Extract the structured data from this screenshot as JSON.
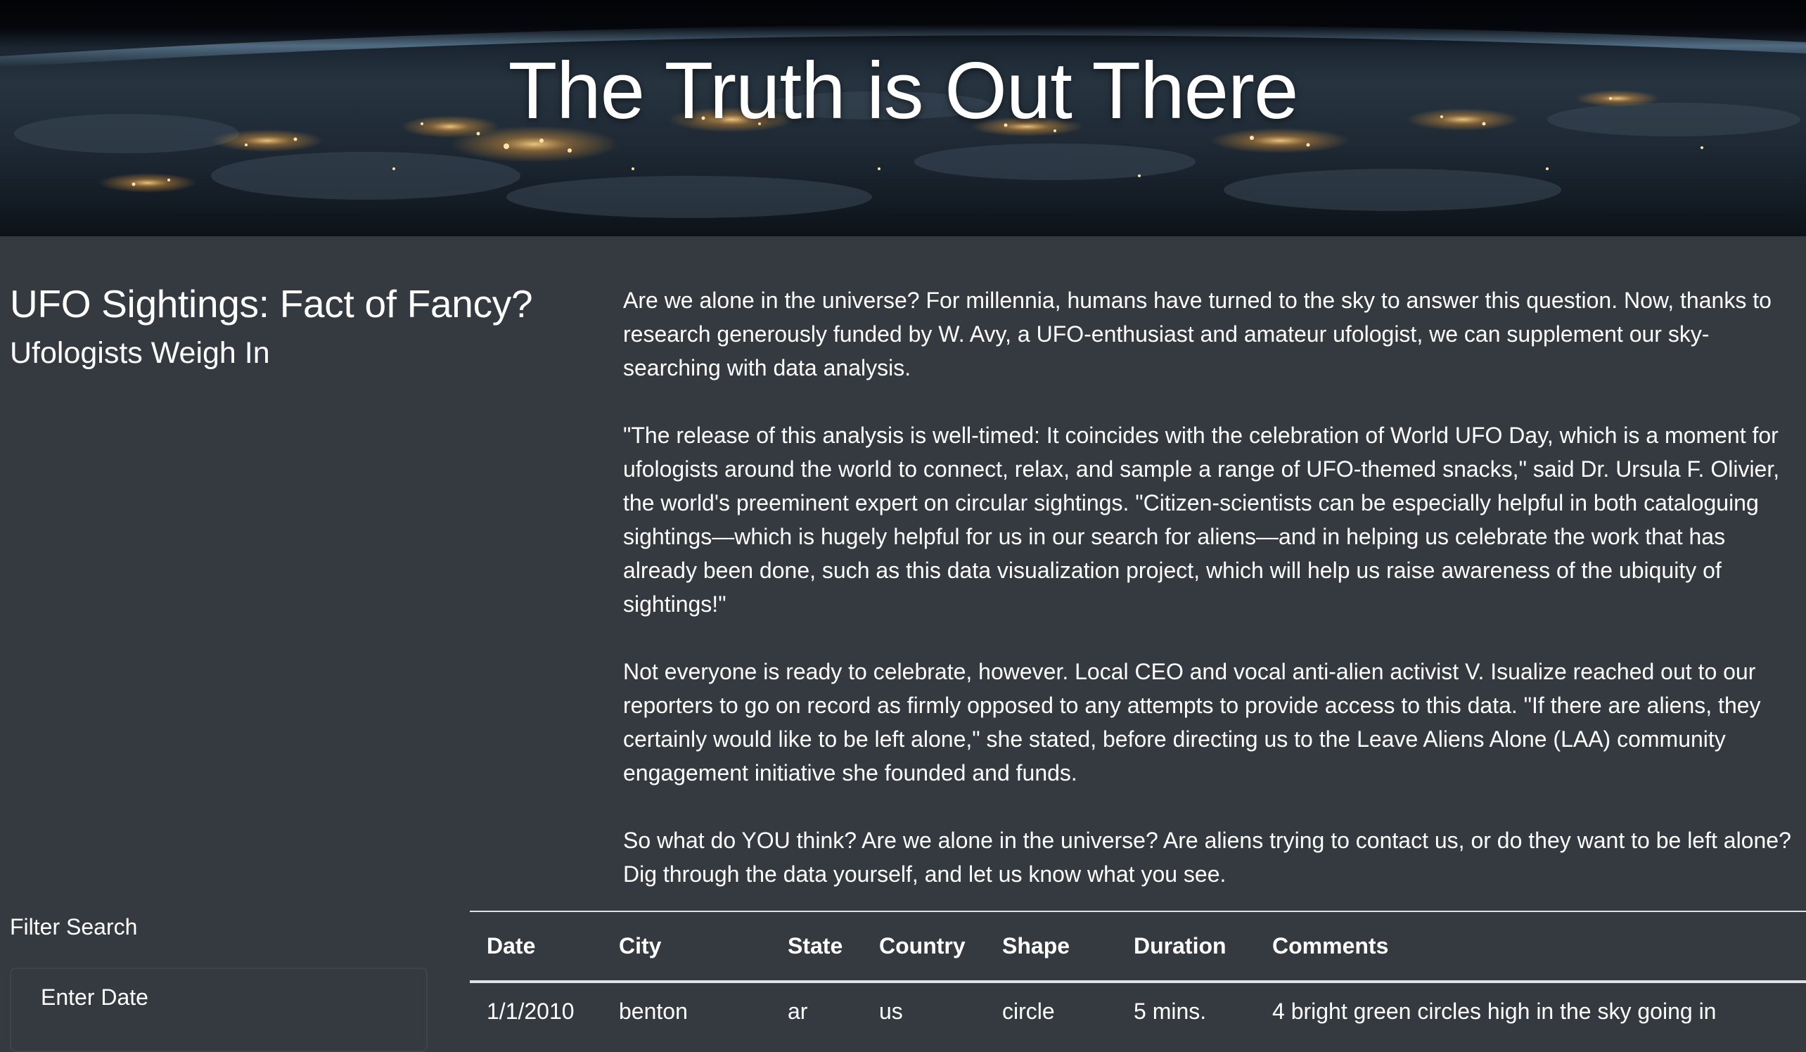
{
  "hero": {
    "title": "The Truth is Out There"
  },
  "intro": {
    "headline": "UFO Sightings: Fact of Fancy?",
    "subheadline": "Ufologists Weigh In"
  },
  "article": {
    "paragraphs": [
      "Are we alone in the universe? For millennia, humans have turned to the sky to answer this question. Now, thanks to research generously funded by W. Avy, a UFO-enthusiast and amateur ufologist, we can supplement our sky-searching with data analysis.",
      "\"The release of this analysis is well-timed: It coincides with the celebration of World UFO Day, which is a moment for ufologists around the world to connect, relax, and sample a range of UFO-themed snacks,\" said Dr. Ursula F. Olivier, the world's preeminent expert on circular sightings. \"Citizen-scientists can be especially helpful in both cataloguing sightings—which is hugely helpful for us in our search for aliens—and in helping us celebrate the work that has already been done, such as this data visualization project, which will help us raise awareness of the ubiquity of sightings!\"",
      "Not everyone is ready to celebrate, however. Local CEO and vocal anti-alien activist V. Isualize reached out to our reporters to go on record as firmly opposed to any attempts to provide access to this data. \"If there are aliens, they certainly would like to be left alone,\" she stated, before directing us to the Leave Aliens Alone (LAA) community engagement initiative she founded and funds.",
      "So what do YOU think? Are we alone in the universe? Are aliens trying to contact us, or do they want to be left alone? Dig through the data yourself, and let us know what you see."
    ]
  },
  "filter": {
    "title": "Filter Search",
    "date_label": "Enter Date"
  },
  "table": {
    "headers": [
      "Date",
      "City",
      "State",
      "Country",
      "Shape",
      "Duration",
      "Comments"
    ],
    "rows": [
      [
        "1/1/2010",
        "benton",
        "ar",
        "us",
        "circle",
        "5 mins.",
        "4 bright green circles high in the sky going in"
      ]
    ]
  },
  "colors": {
    "page_background": "#343a40",
    "text": "#ffffff",
    "table_rule": "#dee2e6"
  }
}
